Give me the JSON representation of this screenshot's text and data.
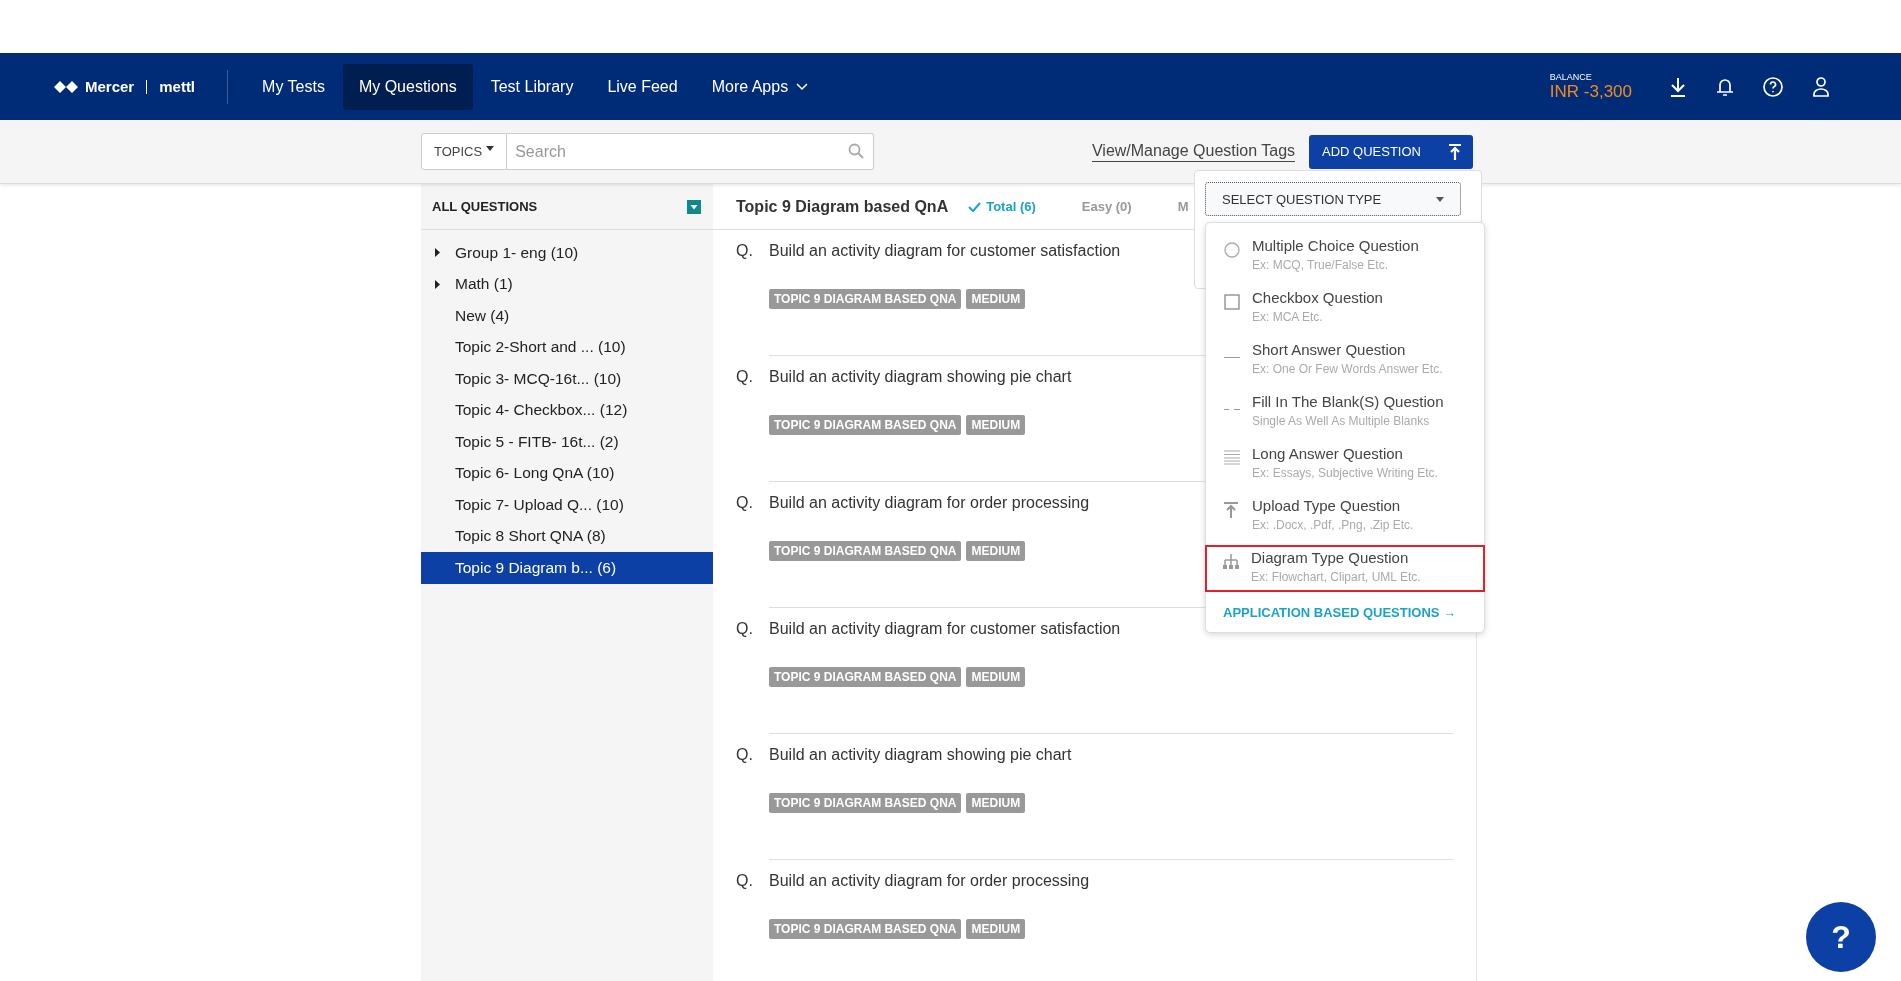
{
  "header": {
    "logo": {
      "brand": "Mercer",
      "product": "mettl"
    },
    "nav": [
      {
        "label": "My Tests",
        "selected": false
      },
      {
        "label": "My Questions",
        "selected": true
      },
      {
        "label": "Test Library",
        "selected": false
      },
      {
        "label": "Live Feed",
        "selected": false
      },
      {
        "label": "More Apps",
        "selected": false,
        "dropdown": true
      }
    ],
    "balance": {
      "label": "BALANCE",
      "value": "INR -3,300"
    }
  },
  "toolbar": {
    "topics_button": "TOPICS",
    "search": {
      "placeholder": "Search"
    },
    "tags_link": "View/Manage Question Tags",
    "add_button": "ADD QUESTION"
  },
  "sidebar": {
    "title": "ALL QUESTIONS",
    "items": [
      {
        "label": "Group 1- eng (10)",
        "expanded": false,
        "selected": false
      },
      {
        "label": "Math (1)",
        "expanded": false,
        "selected": false
      },
      {
        "label": "New (4)",
        "selected": false
      },
      {
        "label": "Topic 2-Short and ... (10)",
        "selected": false
      },
      {
        "label": "Topic 3- MCQ-16t...  (10)",
        "selected": false
      },
      {
        "label": "Topic 4- Checkbox... (12)",
        "selected": false
      },
      {
        "label": "Topic 5 - FITB- 16t...  (2)",
        "selected": false
      },
      {
        "label": "Topic 6- Long QnA (10)",
        "selected": false
      },
      {
        "label": "Topic 7- Upload Q...  (10)",
        "selected": false
      },
      {
        "label": "Topic 8 Short QNA (8)",
        "selected": false
      },
      {
        "label": "Topic 9 Diagram b... (6)",
        "selected": true
      }
    ]
  },
  "main": {
    "title": "Topic 9 Diagram based QnA",
    "filters": [
      {
        "label": "Total (6)",
        "selected": true
      },
      {
        "label": "Easy (0)",
        "selected": false
      },
      {
        "label": "M",
        "selected": false
      }
    ],
    "questions": [
      {
        "prefix": "Q.",
        "text": "Build an activity diagram for customer satisfaction",
        "tags": [
          "TOPIC 9 DIAGRAM BASED QNA",
          "MEDIUM"
        ]
      },
      {
        "prefix": "Q.",
        "text": "Build an activity diagram showing pie chart",
        "tags": [
          "TOPIC 9 DIAGRAM BASED QNA",
          "MEDIUM"
        ]
      },
      {
        "prefix": "Q.",
        "text": "Build an activity diagram for order processing",
        "tags": [
          "TOPIC 9 DIAGRAM BASED QNA",
          "MEDIUM"
        ]
      },
      {
        "prefix": "Q.",
        "text": "Build an activity diagram for customer satisfaction",
        "tags": [
          "TOPIC 9 DIAGRAM BASED QNA",
          "MEDIUM"
        ]
      },
      {
        "prefix": "Q.",
        "text": "Build an activity diagram showing pie chart",
        "tags": [
          "TOPIC 9 DIAGRAM BASED QNA",
          "MEDIUM"
        ]
      },
      {
        "prefix": "Q.",
        "text": "Build an activity diagram for order processing",
        "tags": [
          "TOPIC 9 DIAGRAM BASED QNA",
          "MEDIUM"
        ]
      }
    ]
  },
  "question_type_menu": {
    "select": "SELECT QUESTION TYPE",
    "items": [
      {
        "kind": "radio",
        "label": "Multiple Choice Question",
        "hint": "Ex: MCQ, True/False Etc.",
        "highlighted": false
      },
      {
        "kind": "checkbox",
        "label": "Checkbox Question",
        "hint": "Ex: MCA Etc.",
        "highlighted": false
      },
      {
        "kind": "short",
        "label": "Short Answer Question",
        "hint": "Ex: One Or Few Words Answer Etc.",
        "highlighted": false
      },
      {
        "kind": "blank",
        "label": "Fill In The Blank(S) Question",
        "hint": "Single As Well As Multiple Blanks",
        "highlighted": false
      },
      {
        "kind": "long",
        "label": "Long Answer Question",
        "hint": "Ex: Essays, Subjective Writing Etc.",
        "highlighted": false
      },
      {
        "kind": "upload",
        "label": "Upload Type Question",
        "hint": "Ex: .Docx, .Pdf, .Png, .Zip Etc.",
        "highlighted": false
      },
      {
        "kind": "diagram",
        "label": "Diagram Type Question",
        "hint": "Ex: Flowchart, Clipart, UML Etc.",
        "highlighted": true
      }
    ],
    "footer_link": "APPLICATION BASED QUESTIONS →"
  },
  "help_button": "?"
}
